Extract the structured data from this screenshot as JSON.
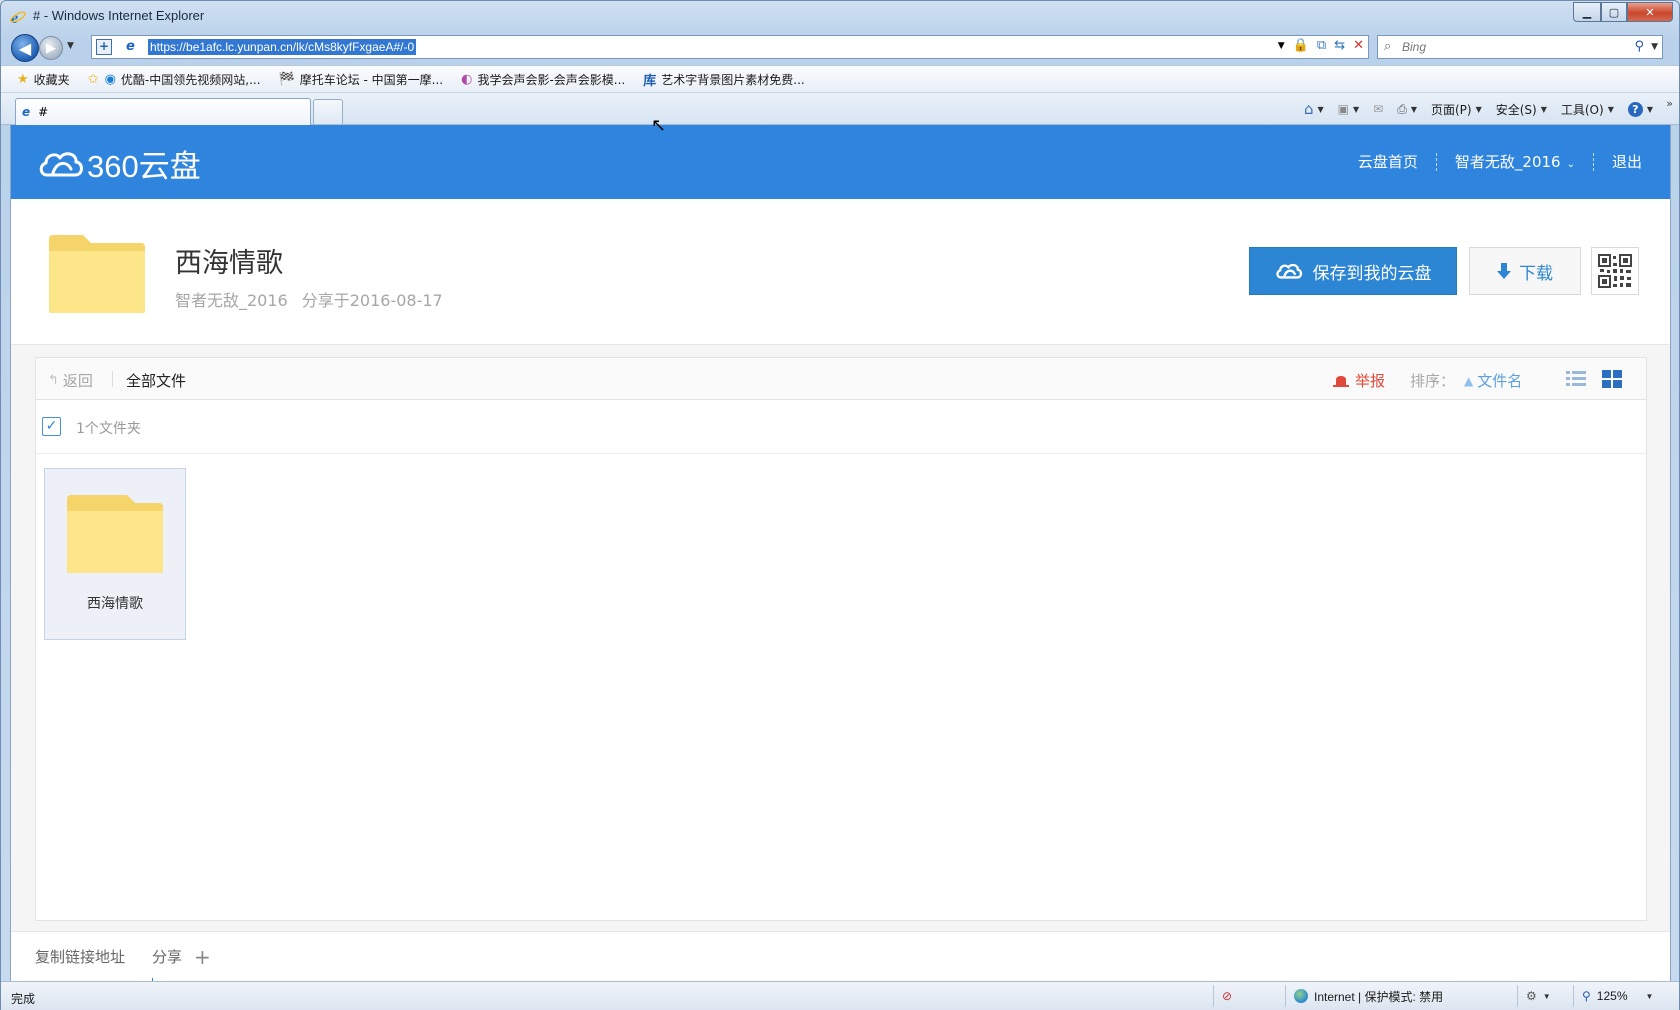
{
  "window": {
    "title": "# - Windows Internet Explorer",
    "minimize_label": "▁",
    "maximize_label": "▢",
    "close_label": "✕"
  },
  "addressbar": {
    "url": "https://be1afc.lc.yunpan.cn/lk/cMs8kyfFxgaeA#/-0",
    "search_placeholder": "Bing"
  },
  "favorites": {
    "label": "收藏夹",
    "items": [
      {
        "label": "优酷-中国领先视频网站,..."
      },
      {
        "label": "摩托车论坛 - 中国第一摩..."
      },
      {
        "label": "我学会声会影-会声会影模..."
      },
      {
        "label": "艺术字背景图片素材免费..."
      }
    ],
    "item3_icon_text": "库"
  },
  "tabs": [
    {
      "label": "#"
    }
  ],
  "commandbar": {
    "page": "页面(P)",
    "safety": "安全(S)",
    "tools": "工具(O)"
  },
  "site": {
    "logo_text": "360云盘",
    "nav": {
      "home": "云盘首页",
      "user": "智者无敌_2016",
      "logout": "退出"
    }
  },
  "share": {
    "title": "西海情歌",
    "owner": "智者无敌_2016",
    "date_text": "分享于2016-08-17",
    "save_label": "保存到我的云盘",
    "download_label": "下载"
  },
  "toolbar": {
    "back_label": "返回",
    "all_files_label": "全部文件",
    "report_label": "举报",
    "sort_label": "排序：",
    "sort_by": "文件名"
  },
  "selection": {
    "count_text": "1个文件夹"
  },
  "files": [
    {
      "name": "西海情歌",
      "type": "folder"
    }
  ],
  "footer": {
    "copy_link_label": "复制链接地址",
    "share_label": "分享",
    "plus_label": "+"
  },
  "status": {
    "text": "完成",
    "zone": "Internet | 保护模式: 禁用",
    "zoom": "125%"
  },
  "colors": {
    "header_blue": "#2f84de",
    "save_button": "#2c86d4",
    "folder_yellow": "#fde58a",
    "report_red": "#e04a3b"
  }
}
